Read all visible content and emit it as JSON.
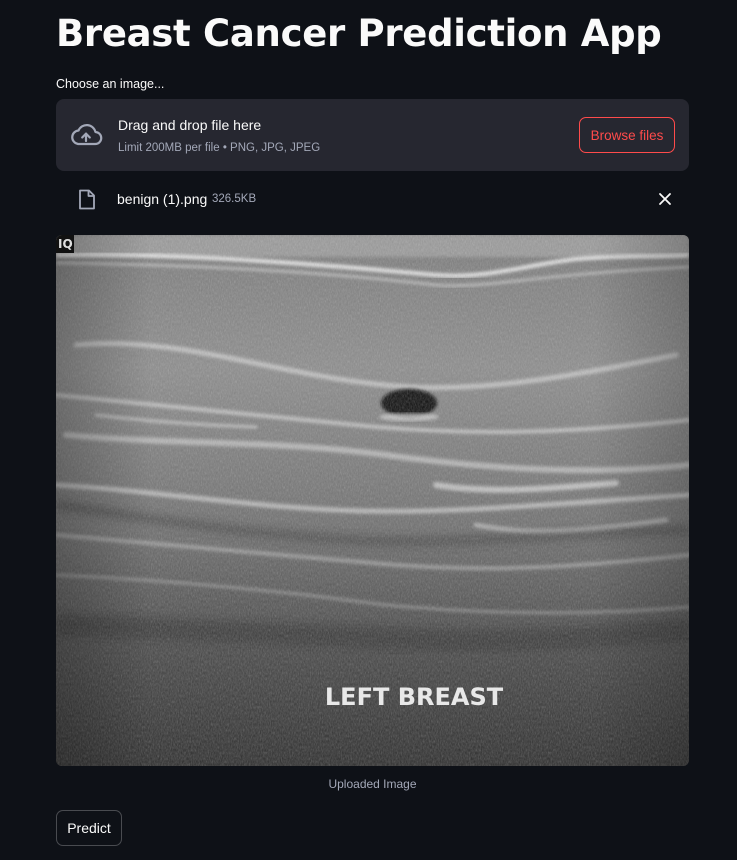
{
  "app": {
    "title": "Breast Cancer Prediction App"
  },
  "uploader": {
    "label": "Choose an image...",
    "drop_title": "Drag and drop file here",
    "limits": "Limit 200MB per file • PNG, JPG, JPEG",
    "browse_label": "Browse files",
    "icon": "cloud-upload-icon"
  },
  "uploaded_file": {
    "name": "benign (1).png",
    "size": "326.5KB",
    "icon": "file-icon",
    "remove_icon": "close-icon"
  },
  "image": {
    "overlay_text": "LEFT BREAST",
    "corner_mark": "IQ",
    "caption": "Uploaded Image"
  },
  "actions": {
    "predict_label": "Predict"
  },
  "colors": {
    "background": "#0e1117",
    "dropzone": "#262730",
    "accent": "#ff4b4b",
    "muted_text": "#a3a8b8"
  }
}
